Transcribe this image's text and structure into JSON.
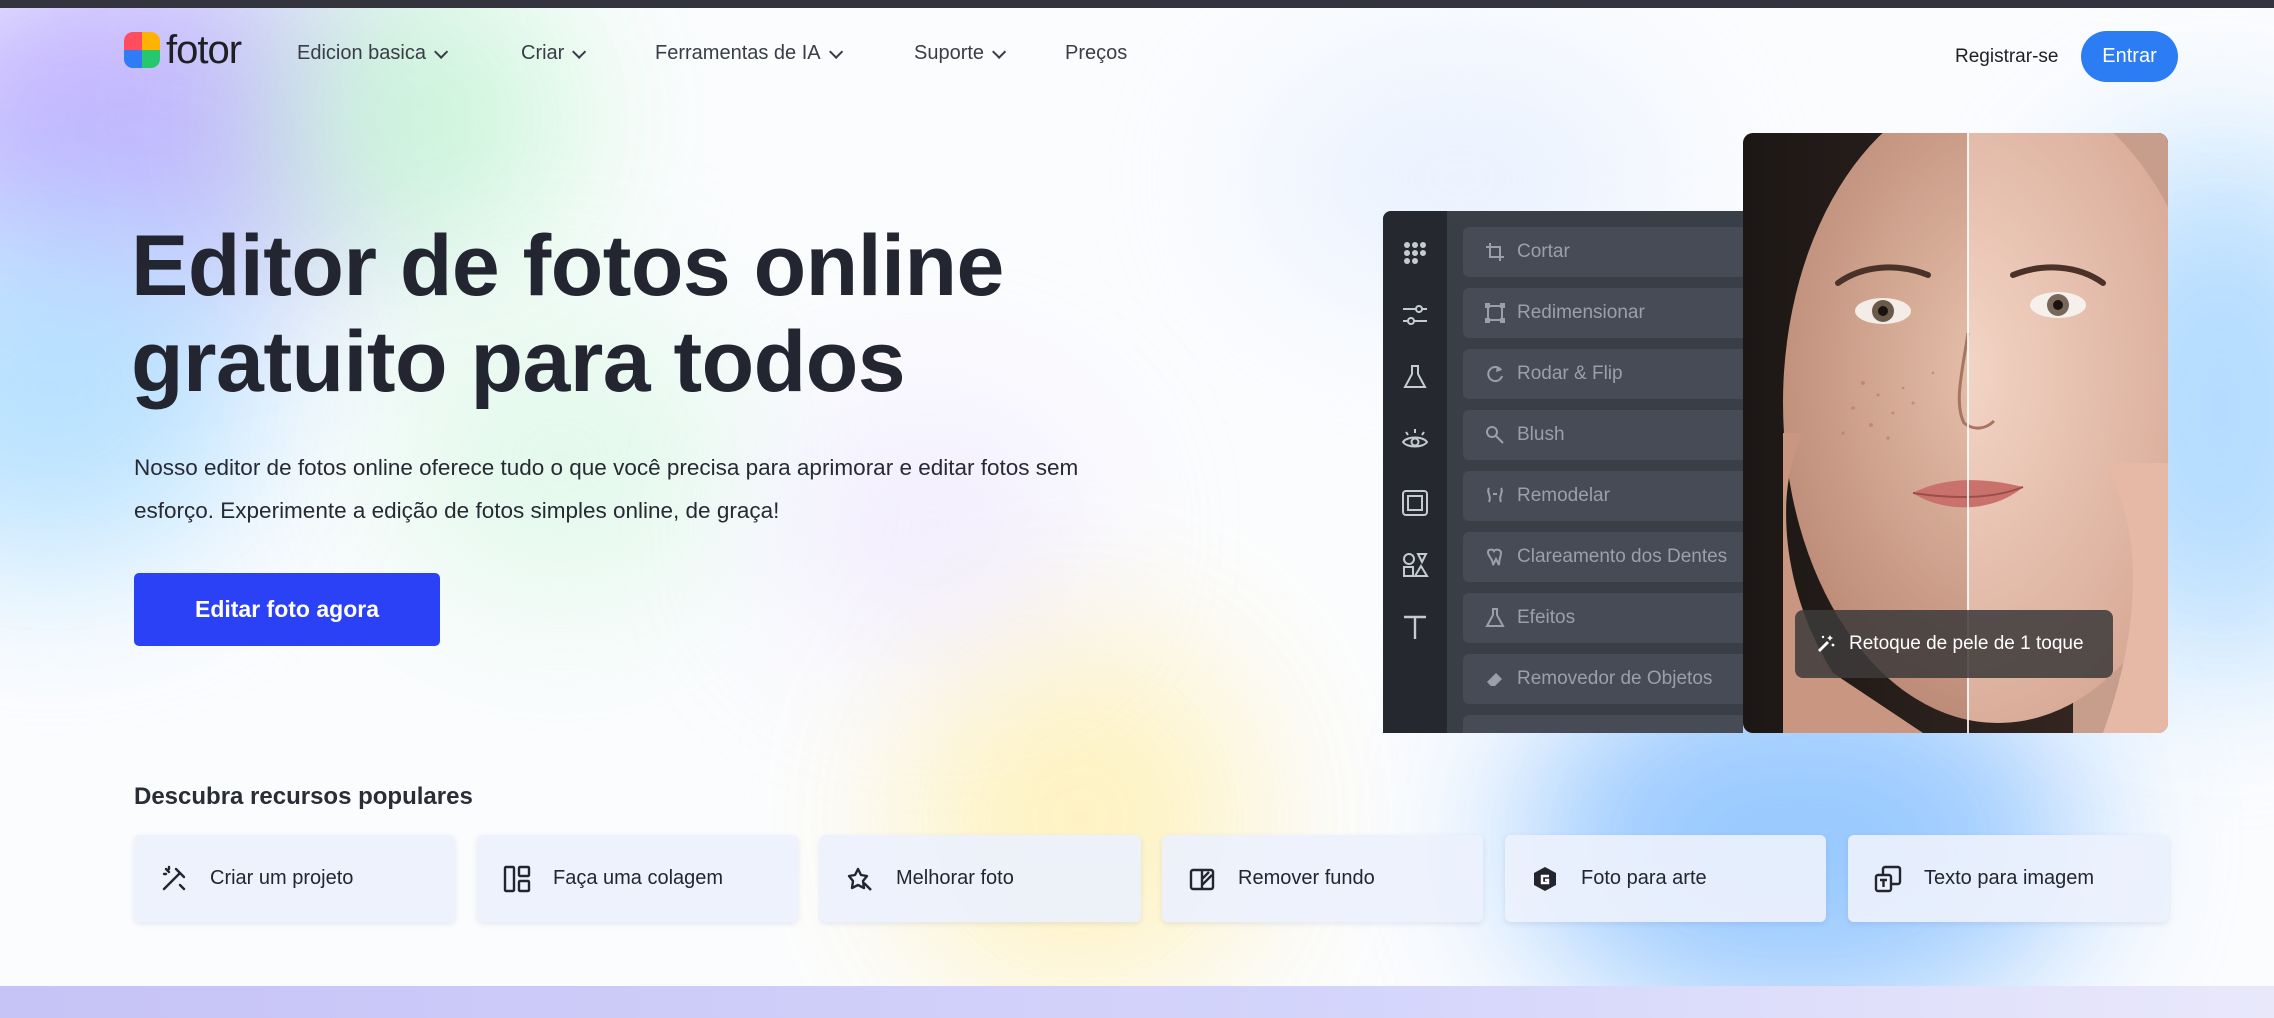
{
  "brand": {
    "name": "fotor",
    "accent": "#2b41f6",
    "login_color": "#2c7cf4"
  },
  "nav": {
    "items": [
      {
        "label": "Edicion basica",
        "dropdown": true
      },
      {
        "label": "Criar",
        "dropdown": true
      },
      {
        "label": "Ferramentas de IA",
        "dropdown": true
      },
      {
        "label": "Suporte",
        "dropdown": true
      },
      {
        "label": "Preços",
        "dropdown": false
      }
    ],
    "register": "Registrar-se",
    "login": "Entrar"
  },
  "hero": {
    "title_line1": "Editor de fotos online",
    "title_line2": "gratuito para todos",
    "description": "Nosso editor de fotos online oferece tudo o que você precisa para aprimorar e editar fotos sem esforço. Experimente a edição de fotos simples online, de graça!",
    "cta": "Editar foto agora"
  },
  "editor": {
    "rail_icons": [
      "apps-icon",
      "adjust-icon",
      "flask-icon",
      "eye-icon",
      "frame-icon",
      "elements-icon",
      "text-icon"
    ],
    "tools": [
      {
        "label": "Cortar",
        "icon": "crop-icon"
      },
      {
        "label": "Redimensionar",
        "icon": "resize-icon"
      },
      {
        "label": "Rodar & Flip",
        "icon": "rotate-icon"
      },
      {
        "label": "Blush",
        "icon": "blush-icon"
      },
      {
        "label": "Remodelar",
        "icon": "reshape-icon"
      },
      {
        "label": "Clareamento dos Dentes",
        "icon": "teeth-icon"
      },
      {
        "label": "Efeitos",
        "icon": "effects-icon"
      },
      {
        "label": "Removedor de Objetos",
        "icon": "eraser-icon"
      }
    ],
    "badge": "Retoque de pele de 1 toque"
  },
  "popular": {
    "title": "Descubra recursos populares",
    "items": [
      {
        "label": "Criar um projeto",
        "icon": "magic-pen-icon"
      },
      {
        "label": "Faça uma colagem",
        "icon": "collage-icon"
      },
      {
        "label": "Melhorar foto",
        "icon": "enhance-icon"
      },
      {
        "label": "Remover fundo",
        "icon": "remove-bg-icon"
      },
      {
        "label": "Foto para arte",
        "icon": "ai-art-icon"
      },
      {
        "label": "Texto para imagem",
        "icon": "text-to-image-icon"
      }
    ]
  }
}
